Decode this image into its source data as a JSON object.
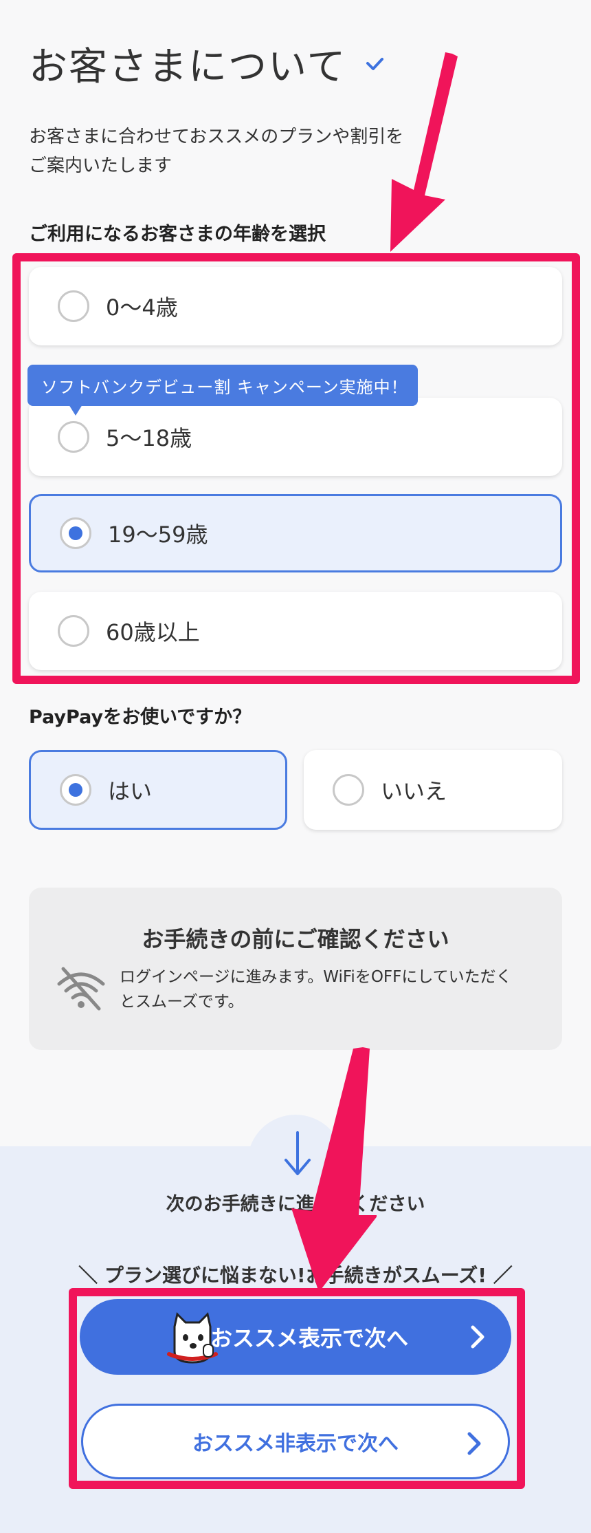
{
  "header": {
    "title": "お客さまについて",
    "check_icon": "check-icon"
  },
  "intro": {
    "line1": "お客さまに合わせておススメのプランや割引を",
    "line2": "ご案内いたします"
  },
  "age": {
    "label": "ご利用になるお客さまの年齢を選択",
    "options": [
      {
        "label": "0〜4歳",
        "selected": false
      },
      {
        "label": "5〜18歳",
        "selected": false
      },
      {
        "label": "19〜59歳",
        "selected": true
      },
      {
        "label": "60歳以上",
        "selected": false
      }
    ],
    "badge": "ソフトバンクデビュー割 キャンペーン実施中！"
  },
  "paypay": {
    "label": "PayPayをお使いですか？",
    "options": [
      {
        "label": "はい",
        "selected": true
      },
      {
        "label": "いいえ",
        "selected": false
      }
    ]
  },
  "notice": {
    "title": "お手続きの前にご確認ください",
    "line1": "ログインページに進みます。WiFiをOFFにしていただく",
    "line2": "とスムーズです。",
    "icon": "wifi-off-icon"
  },
  "next": {
    "text": "次のお手続きに進んでください",
    "promo": "＼ プラン選びに悩まない!お手続きがスムーズ! ／",
    "primary_button": "おススメ表示で次へ",
    "secondary_button": "おススメ非表示で次へ"
  },
  "colors": {
    "accent": "#4070df",
    "selected_bg": "#eaf0fc",
    "annotation": "#f0145a"
  }
}
